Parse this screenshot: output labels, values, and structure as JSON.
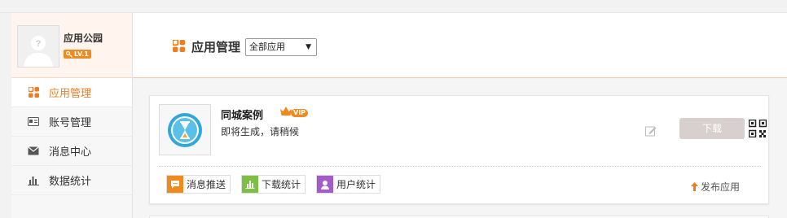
{
  "profile": {
    "username": "应用公园",
    "level": "LV.1"
  },
  "sidebar": {
    "items": [
      {
        "label": "应用管理",
        "icon": "apps-grid-icon",
        "active": true
      },
      {
        "label": "账号管理",
        "icon": "id-card-icon",
        "active": false
      },
      {
        "label": "消息中心",
        "icon": "envelope-icon",
        "active": false
      },
      {
        "label": "数据统计",
        "icon": "bar-chart-icon",
        "active": false
      }
    ]
  },
  "header": {
    "title": "应用管理",
    "filter_value": "全部应用"
  },
  "app": {
    "name": "同城案例",
    "vip_label": "VIP",
    "status": "即将生成，请稍候",
    "download_label": "下载",
    "actions": [
      {
        "label": "消息推送",
        "color": "#f08a1e",
        "icon": "message-icon"
      },
      {
        "label": "下载统计",
        "color": "#7bc043",
        "icon": "bar-chart-icon"
      },
      {
        "label": "用户统计",
        "color": "#a35bc7",
        "icon": "user-icon"
      }
    ],
    "publish_label": "发布应用"
  },
  "colors": {
    "accent": "#f07c1e",
    "download_disabled": "#d8d0ce"
  }
}
